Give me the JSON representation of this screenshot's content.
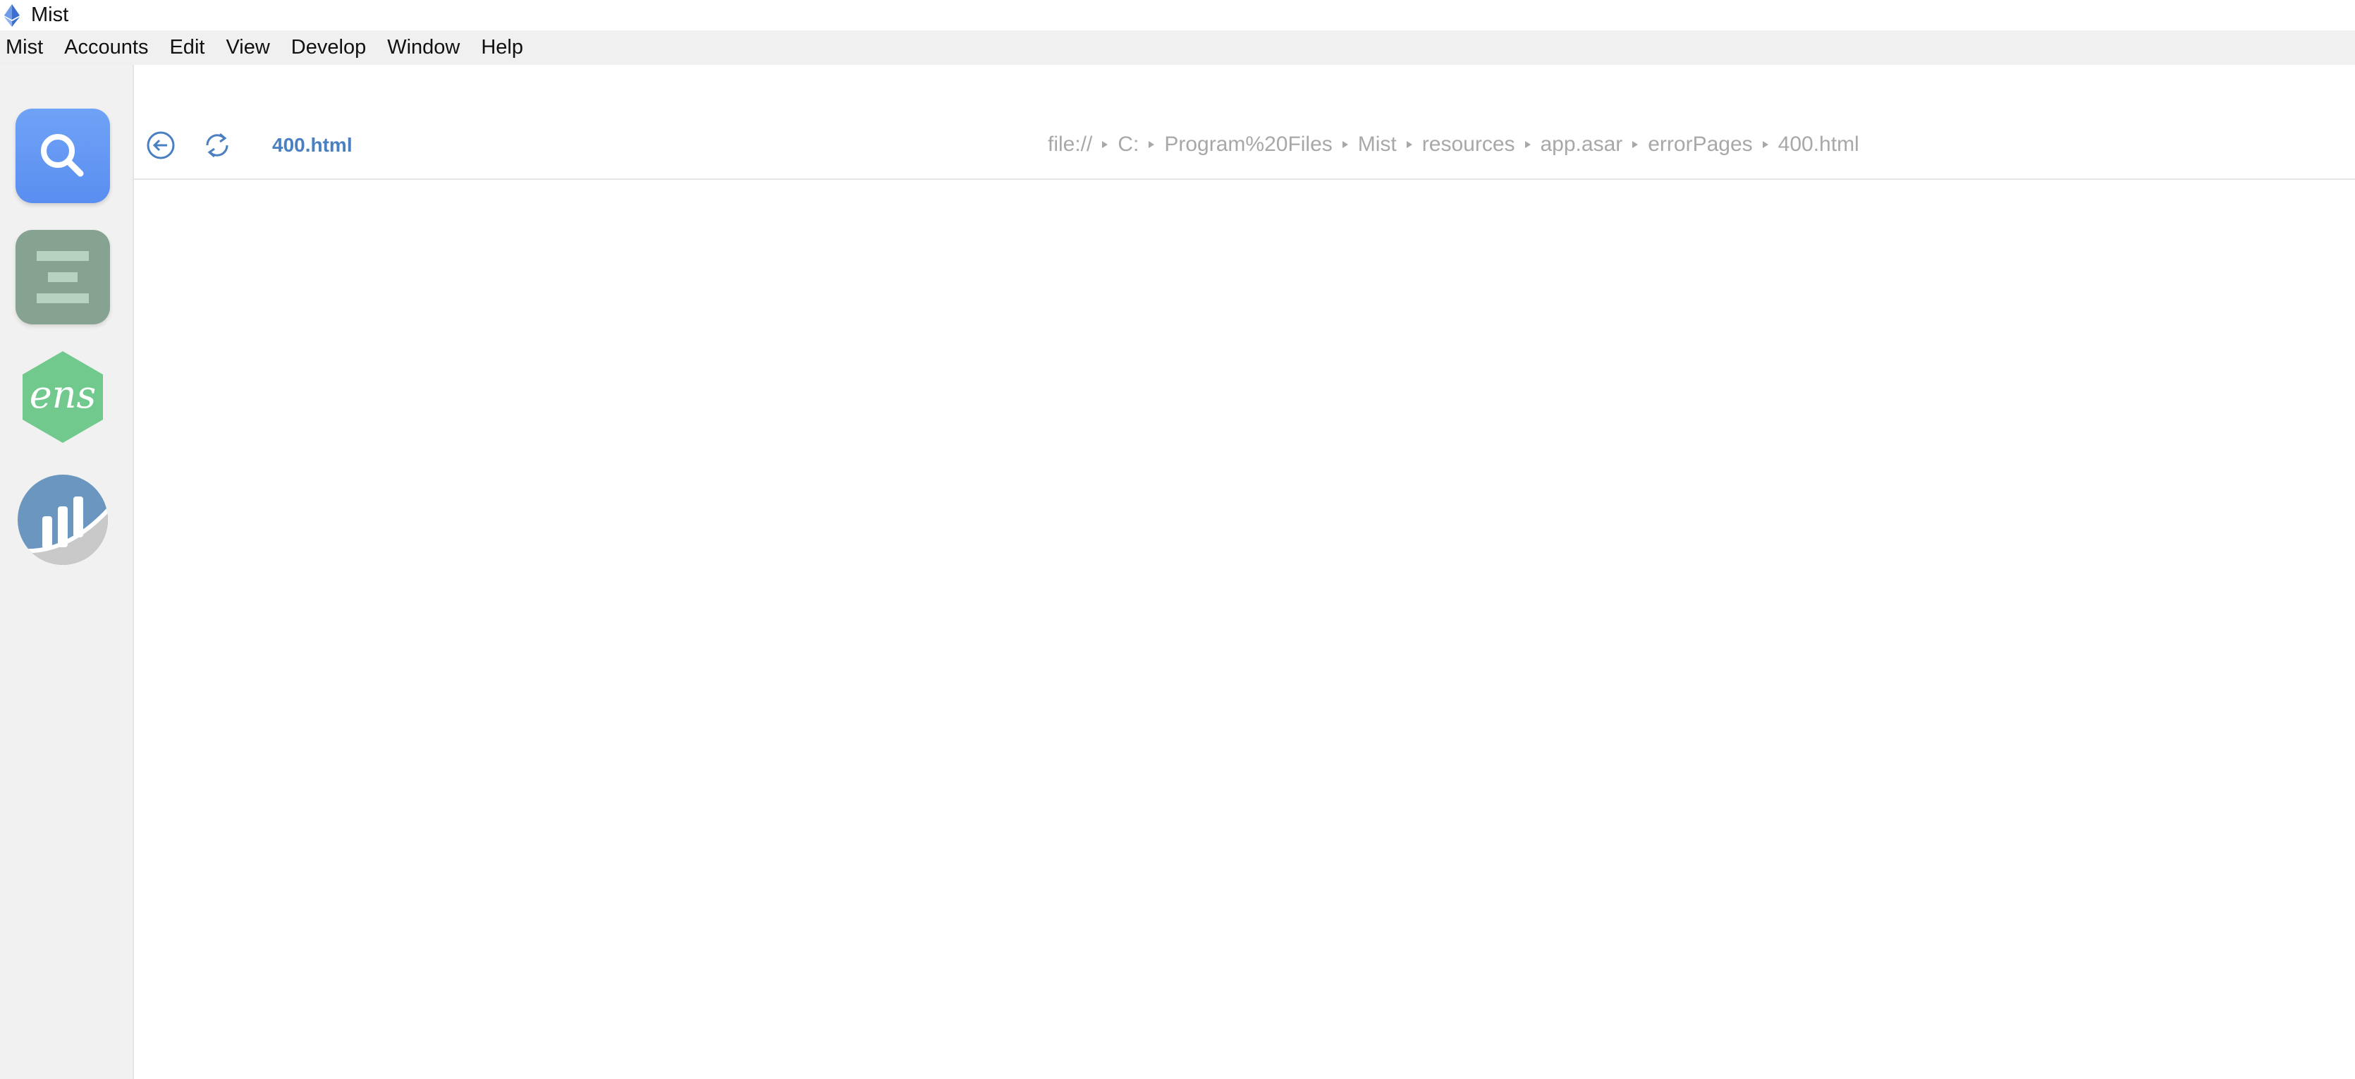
{
  "window": {
    "title": "Mist",
    "logo_icon": "ethereum-icon"
  },
  "menubar": {
    "items": [
      "Mist",
      "Accounts",
      "Edit",
      "View",
      "Develop",
      "Window",
      "Help"
    ]
  },
  "sidebar": {
    "dapps": [
      {
        "icon": "search-icon",
        "color": "#5f93f2"
      },
      {
        "icon": "wallet-icon",
        "color": "#86a392"
      },
      {
        "icon": "ens-icon",
        "color": "#72c98e",
        "logo_text": "ens"
      },
      {
        "icon": "stats-icon",
        "color": "#6a96bf"
      }
    ]
  },
  "browser": {
    "page_name": "400.html",
    "back_icon": "back-arrow-icon",
    "reload_icon": "reload-icon",
    "accent_color": "#4a7fc1",
    "breadcrumb": [
      "file://",
      "C:",
      "Program%20Files",
      "Mist",
      "resources",
      "app.asar",
      "errorPages",
      "400.html"
    ]
  }
}
